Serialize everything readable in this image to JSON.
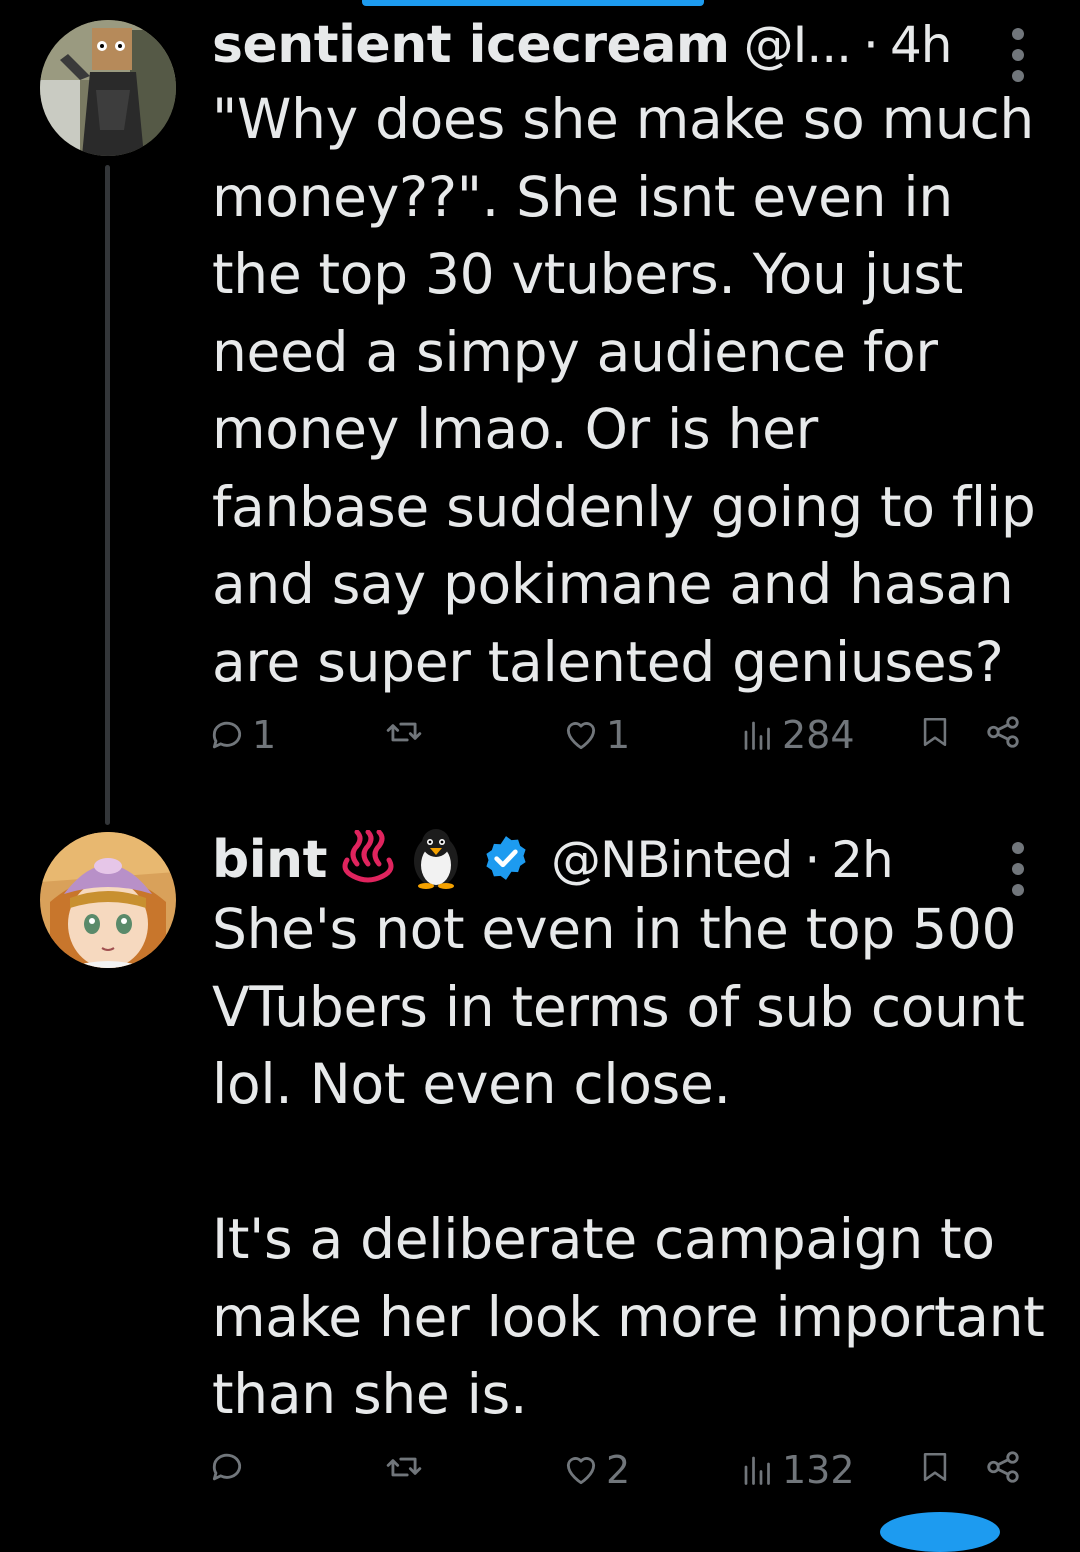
{
  "tweets": [
    {
      "name": "sentient icecream",
      "handle": "@I...",
      "time": "4h",
      "text": "\"Why does she make so much money??\". She isnt even in the top 30 vtubers. You just need a simpy audience for money lmao. Or is her fanbase suddenly going to flip and say pokimane and hasan are super talented geniuses?",
      "replies": "1",
      "likes": "1",
      "views": "284"
    },
    {
      "name": "bint",
      "emojis": [
        "hot-springs",
        "penguin"
      ],
      "verified": true,
      "handle": "@NBinted",
      "time": "2h",
      "text": "She's not even in the top 500 VTubers in terms of sub count lol. Not even close.\n\nIt's a deliberate campaign to make her look more important than she is.",
      "likes": "2",
      "views": "132"
    }
  ],
  "colors": {
    "background": "#000000",
    "text": "#e7e9ea",
    "muted": "#71767b",
    "accent": "#1d9bf0",
    "hot_springs": "#e0245e"
  },
  "icons": [
    "reply-icon",
    "retweet-icon",
    "like-icon",
    "views-icon",
    "bookmark-icon",
    "share-icon",
    "more-icon",
    "verified-icon"
  ]
}
